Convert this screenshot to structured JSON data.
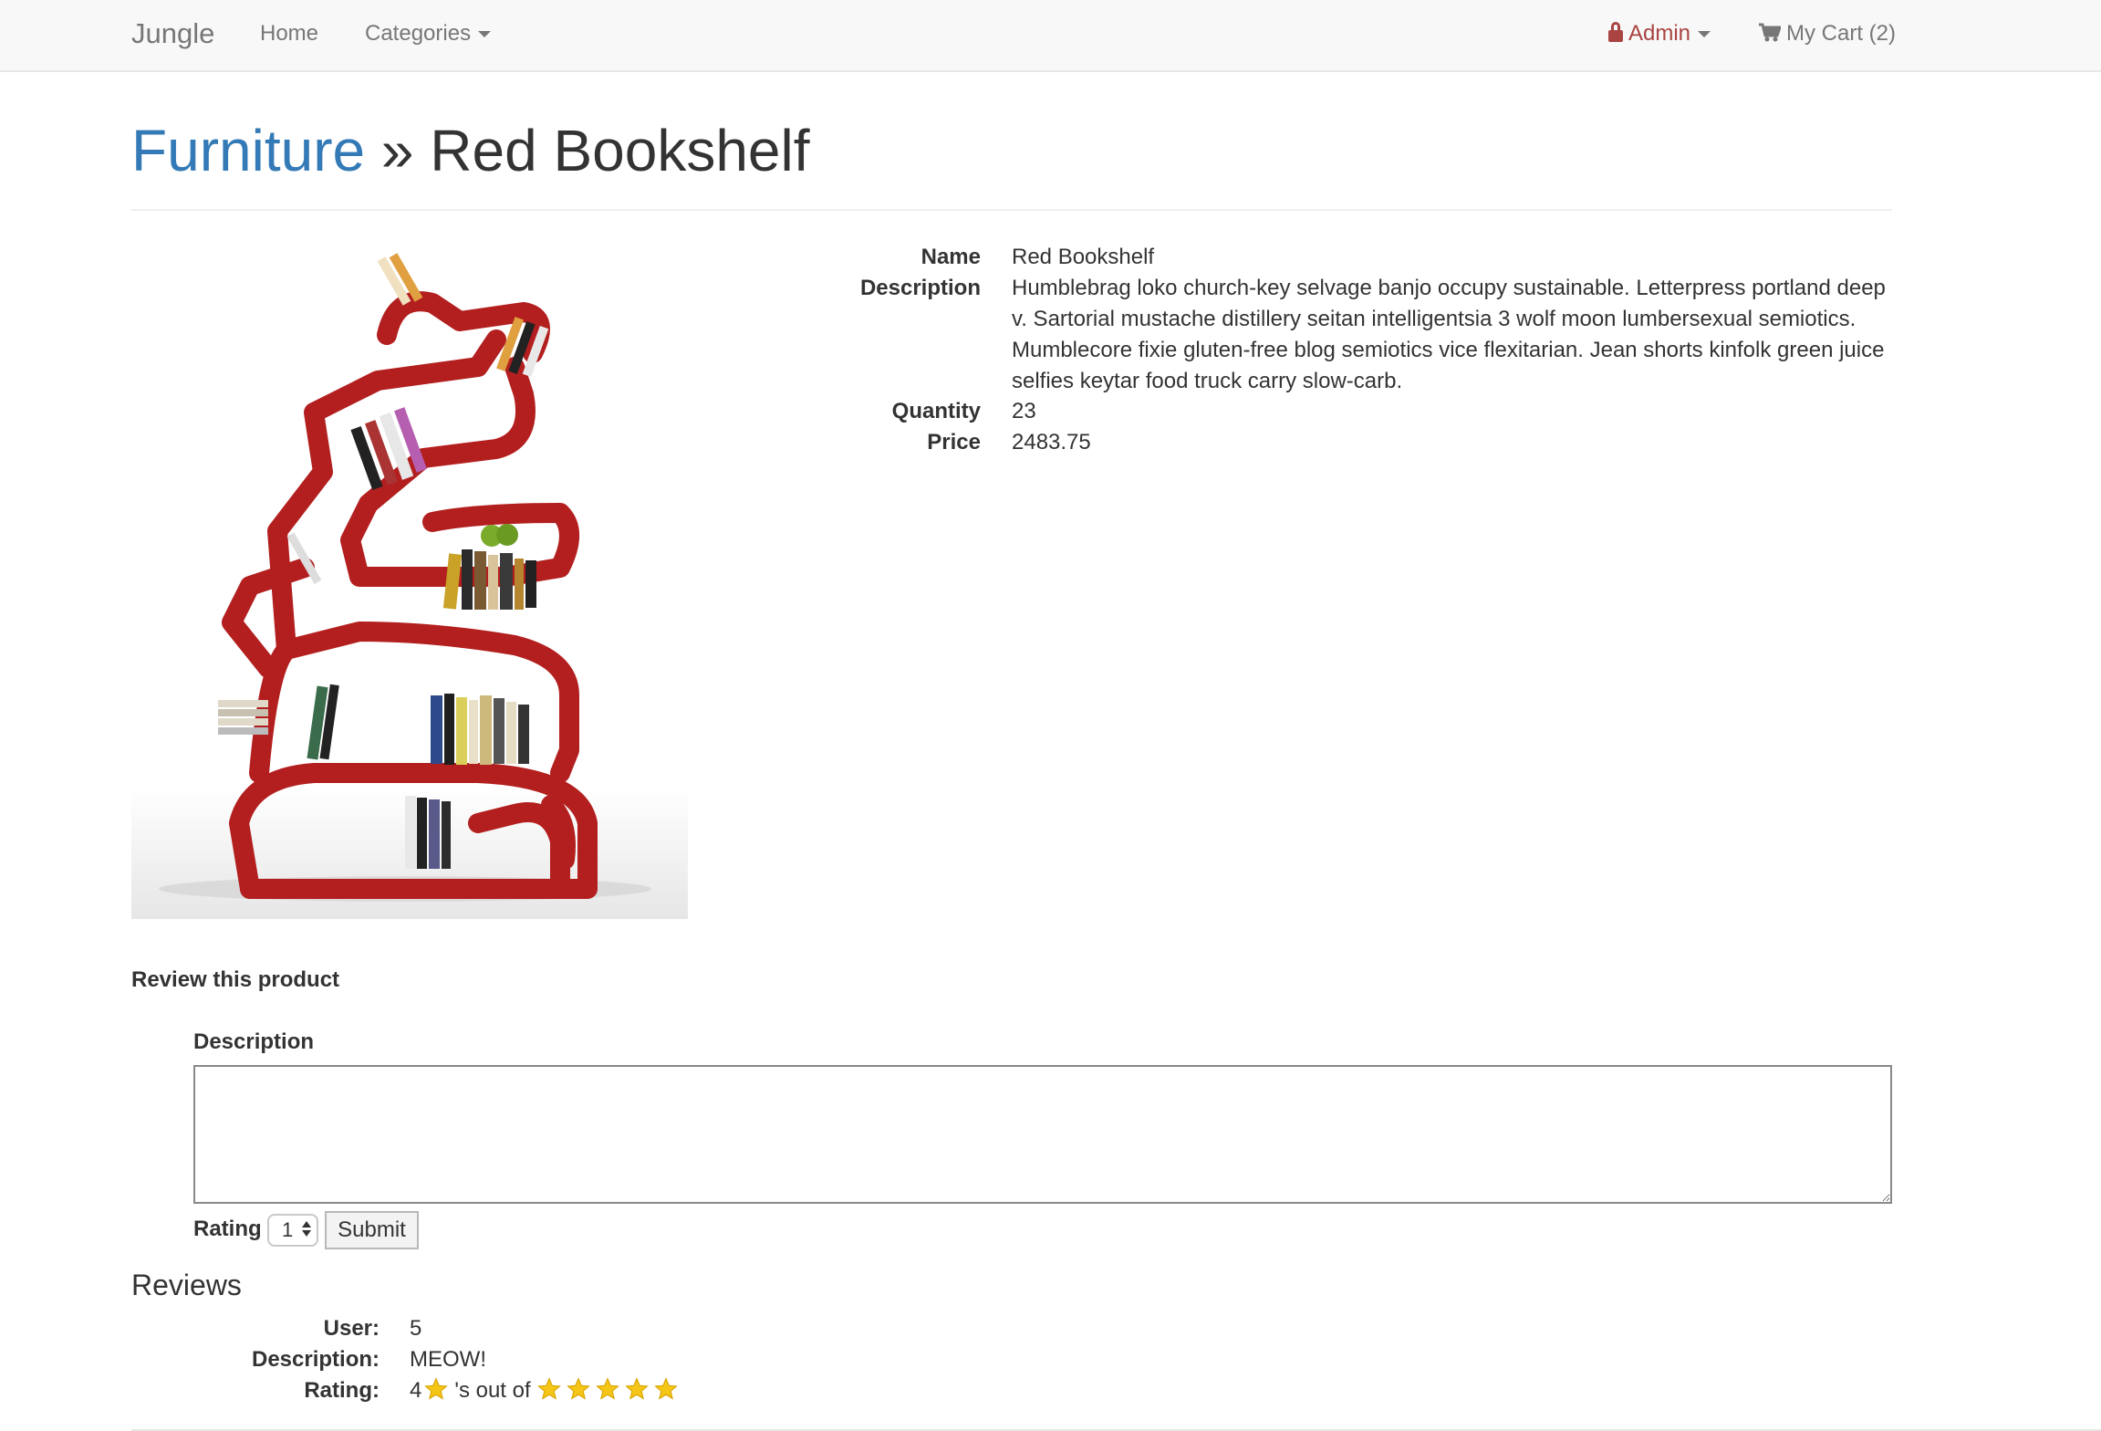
{
  "navbar": {
    "brand": "Jungle",
    "home": "Home",
    "categories": "Categories",
    "admin": "Admin",
    "cart": "My Cart (2)"
  },
  "header": {
    "category": "Furniture",
    "separator": "»",
    "product": "Red Bookshelf"
  },
  "product": {
    "name_label": "Name",
    "name": "Red Bookshelf",
    "description_label": "Description",
    "description": "Humblebrag loko church-key selvage banjo occupy sustainable. Letterpress portland deep v. Sartorial mustache distillery seitan intelligentsia 3 wolf moon lumbersexual semiotics. Mumblecore fixie gluten-free blog semiotics vice flexitarian. Jean shorts kinfolk green juice selfies keytar food truck carry slow-carb.",
    "quantity_label": "Quantity",
    "quantity": "23",
    "price_label": "Price",
    "price": "2483.75"
  },
  "review_form": {
    "heading": "Review this product",
    "description_label": "Description",
    "description_value": "",
    "rating_label": "Rating",
    "rating_selected": "1",
    "submit_label": "Submit"
  },
  "reviews": {
    "heading": "Reviews",
    "items": [
      {
        "user_label": "User:",
        "user": "5",
        "description_label": "Description:",
        "description": "MEOW!",
        "rating_label": "Rating:",
        "rating": "4",
        "rating_text": "'s out of",
        "stars_total": 5
      }
    ]
  },
  "colors": {
    "link": "#337ab7",
    "admin": "#a94442",
    "bookshelf": "#b31f1f",
    "star": "#f5c518"
  }
}
